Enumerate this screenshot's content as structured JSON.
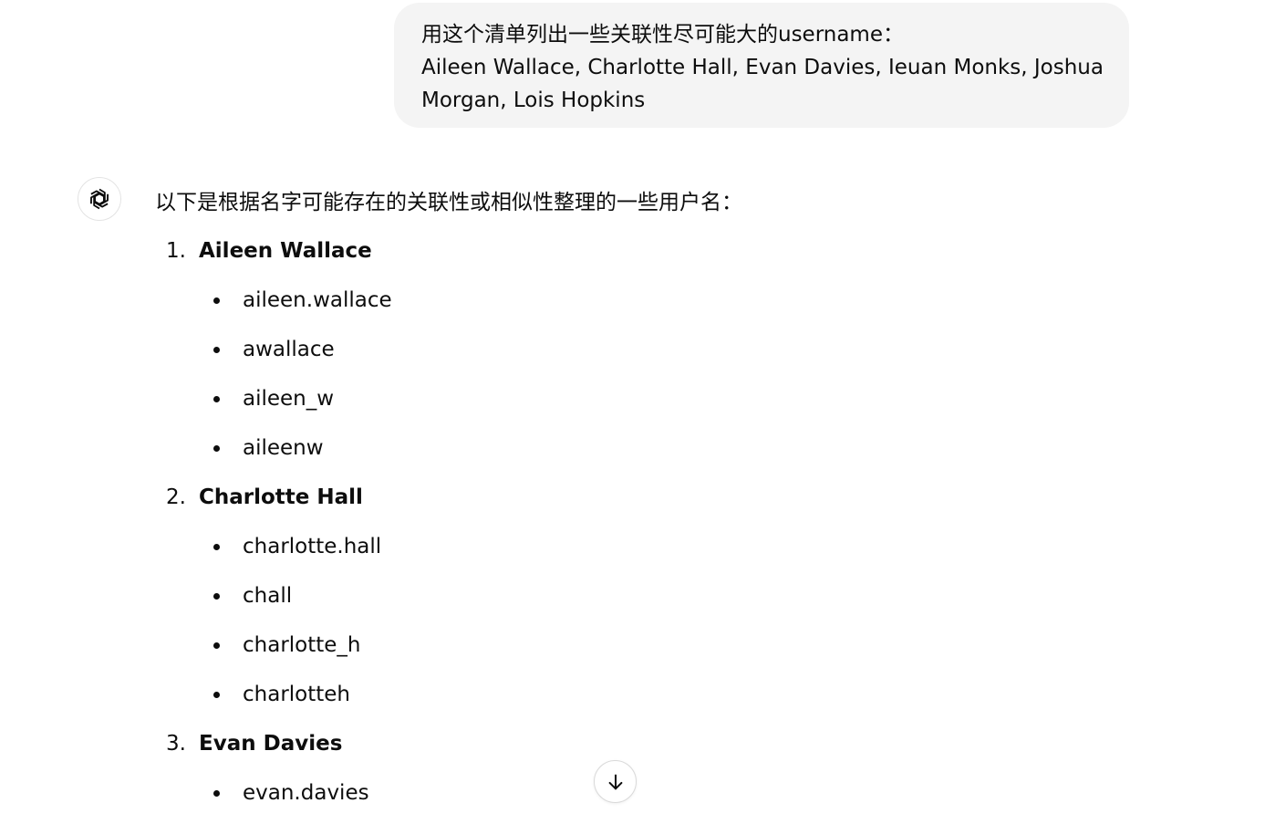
{
  "user_message": {
    "line1": "用这个清单列出一些关联性尽可能大的username：",
    "line2": "Aileen Wallace, Charlotte Hall, Evan Davies, Ieuan Monks, Joshua",
    "line3": "Morgan, Lois Hopkins"
  },
  "assistant": {
    "avatar_icon": "openai-logo-icon",
    "intro": "以下是根据名字可能存在的关联性或相似性整理的一些用户名：",
    "groups": [
      {
        "number": "1.",
        "name": "Aileen Wallace",
        "usernames": [
          "aileen.wallace",
          "awallace",
          "aileen_w",
          "aileenw"
        ]
      },
      {
        "number": "2.",
        "name": "Charlotte Hall",
        "usernames": [
          "charlotte.hall",
          "chall",
          "charlotte_h",
          "charlotteh"
        ]
      },
      {
        "number": "3.",
        "name": "Evan Davies",
        "usernames": [
          "evan.davies"
        ]
      }
    ]
  },
  "scroll_button": {
    "icon": "arrow-down-icon"
  }
}
